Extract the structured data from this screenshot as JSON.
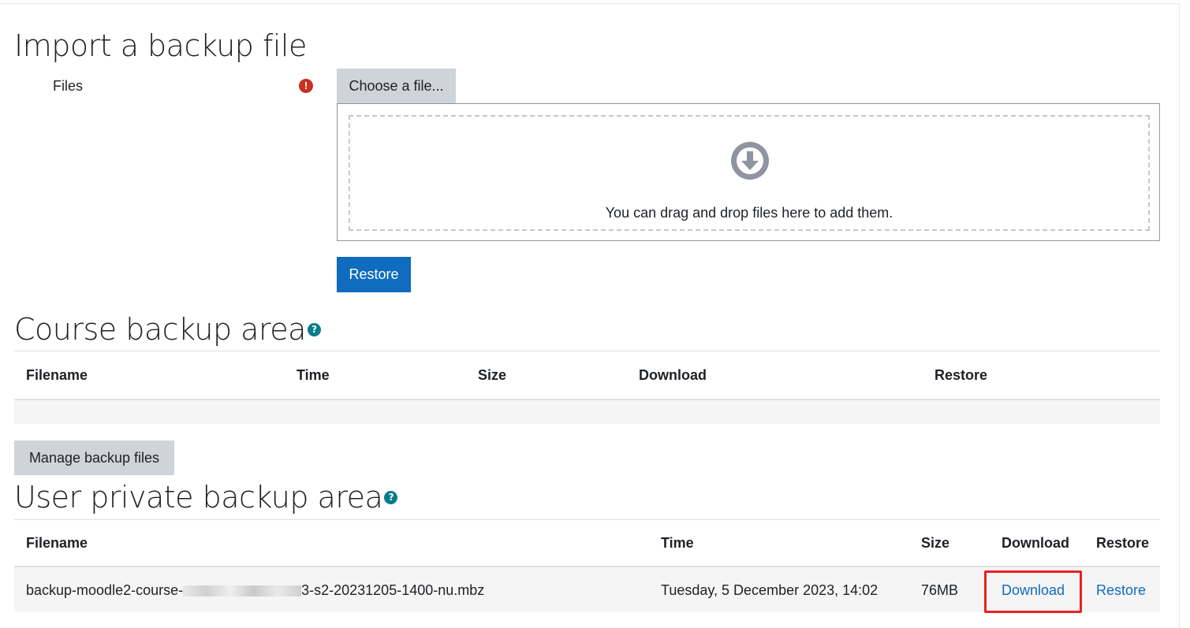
{
  "import": {
    "title": "Import a backup file",
    "files_label": "Files",
    "required_icon": "exclamation-icon",
    "choose_label": "Choose a file...",
    "drop_icon": "download-arrow-icon",
    "drop_text": "You can drag and drop files here to add them.",
    "restore_label": "Restore"
  },
  "course_area": {
    "title": "Course backup area",
    "help_icon": "question-circle-icon",
    "columns": [
      "Filename",
      "Time",
      "Size",
      "Download",
      "Restore"
    ],
    "manage_label": "Manage backup files"
  },
  "user_area": {
    "title": "User private backup area",
    "help_icon": "question-circle-icon",
    "columns": [
      "Filename",
      "Time",
      "Size",
      "Download",
      "Restore"
    ],
    "rows": [
      {
        "filename_prefix": "backup-moodle2-course-",
        "filename_suffix": "3-s2-20231205-1400-nu.mbz",
        "time": "Tuesday, 5 December 2023, 14:02",
        "size": "76MB",
        "download": "Download",
        "restore": "Restore"
      }
    ]
  },
  "colors": {
    "primary": "#0f6cbf",
    "secondary_button": "#ced4da",
    "required": "#ca3120",
    "highlight": "#e8221e",
    "help": "#0a7c8c"
  }
}
